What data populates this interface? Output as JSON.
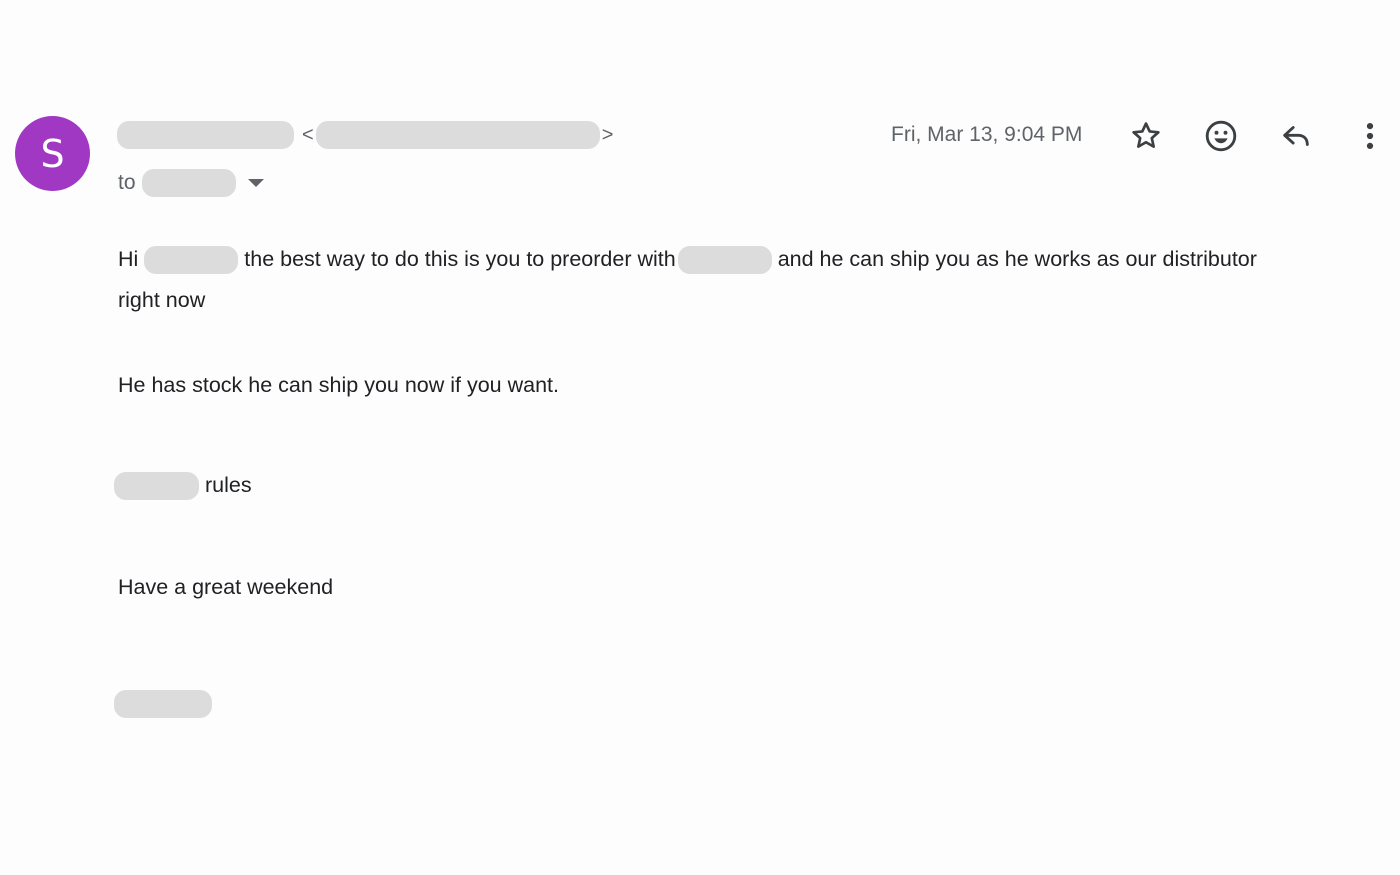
{
  "sender": {
    "avatar_letter": "S",
    "avatar_color": "#a038c4",
    "angle_open": "<",
    "angle_close": ">"
  },
  "recipient": {
    "to_label": "to"
  },
  "date": "Fri, Mar 13, 9:04 PM",
  "actions": {
    "star_icon": "star-icon",
    "emoji_icon": "emoji-icon",
    "reply_icon": "reply-icon",
    "more_icon": "more-vert-icon"
  },
  "body": {
    "line1_hi": "Hi",
    "line1_mid": "the best way to do this is you to preorder with",
    "line1_end": "and he can ship you as he works as our distributor",
    "line2": "right now",
    "para2": "He has stock he can ship you now if you want.",
    "para3_end": "rules",
    "para4": "Have a great weekend"
  },
  "colors": {
    "redaction": "#dcdcdc",
    "secondary_text": "#5f6368",
    "primary_text": "#202124"
  }
}
